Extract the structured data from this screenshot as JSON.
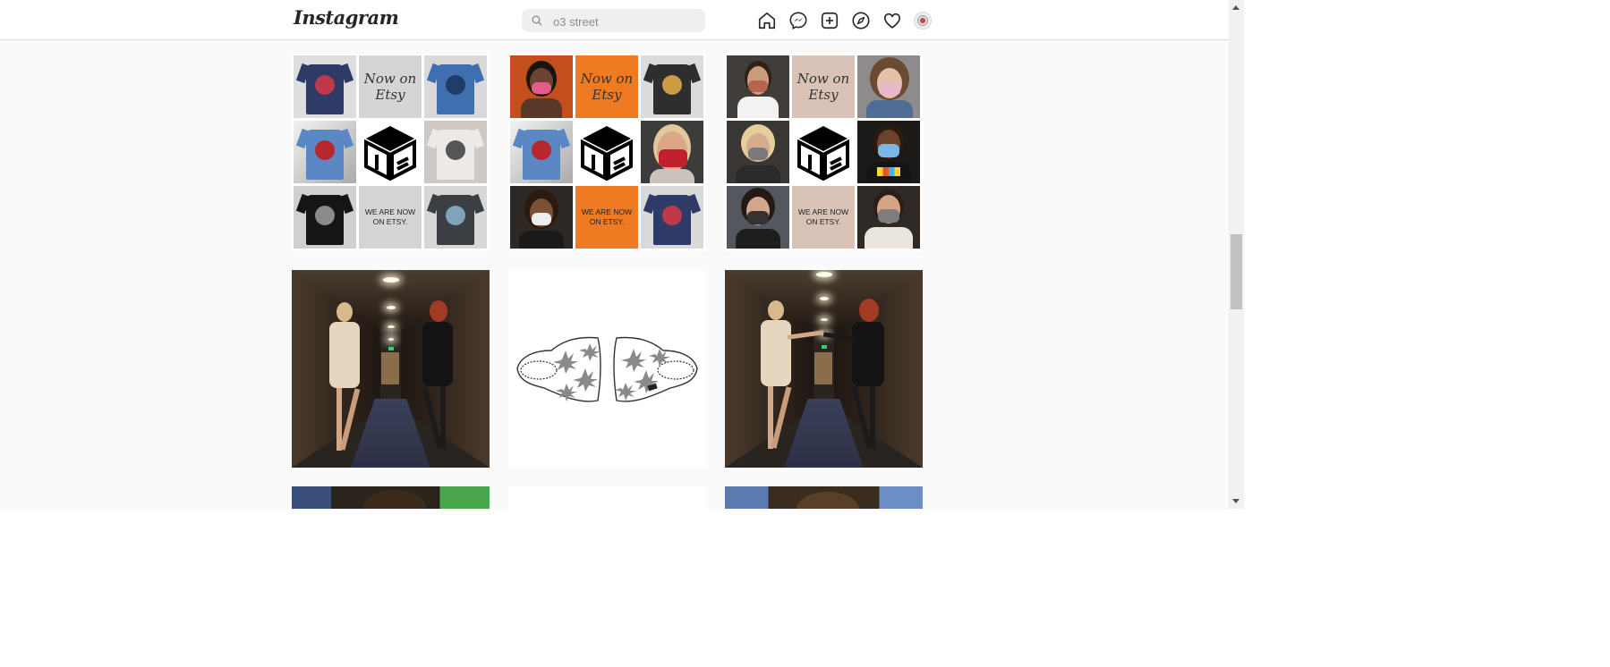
{
  "app": {
    "logo": "Instagram"
  },
  "search": {
    "value": "o3 street",
    "icon": "search-icon"
  },
  "nav": {
    "icons": [
      "home-icon",
      "messenger-icon",
      "new-post-icon",
      "explore-icon",
      "activity-heart-icon",
      "profile-avatar"
    ]
  },
  "collage": {
    "now_on_etsy": [
      "Now on",
      "Etsy"
    ],
    "we_are_now": "WE ARE NOW ON ETSY."
  },
  "colors": {
    "accent_orange": "#f07a21",
    "etsy_beige": "#d9c2b6",
    "etsy_grey": "#d4d6d5"
  }
}
